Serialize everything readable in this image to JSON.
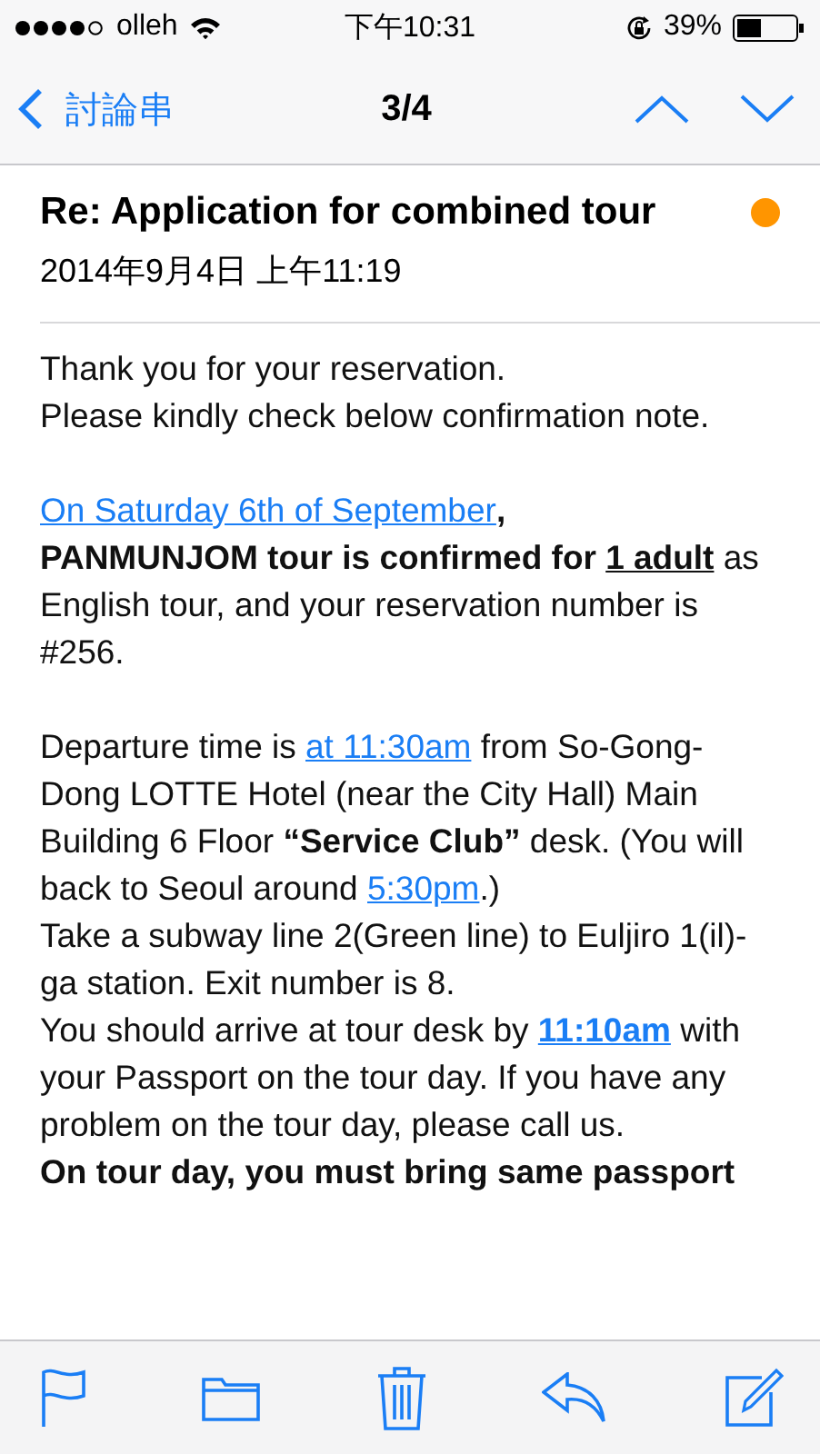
{
  "status_bar": {
    "carrier": "olleh",
    "time": "下午10:31",
    "battery": "39%"
  },
  "nav_bar": {
    "back": "討論串",
    "position": "3/4"
  },
  "message": {
    "subject": "Re: Application for combined tour",
    "unread": true,
    "date": "2014年9月4日 上午11:19",
    "blocks": [
      [
        {
          "segments": [
            {
              "kind": "text",
              "text": "Thank you for your reservation."
            }
          ]
        },
        {
          "segments": [
            {
              "kind": "text",
              "text": "Please kindly check below confirmation note."
            }
          ]
        }
      ],
      [
        {
          "segments": [
            {
              "kind": "link",
              "text": "On Saturday 6th of September"
            },
            {
              "kind": "bold",
              "text": ",\nPANMUNJOM tour is confirmed for "
            },
            {
              "kind": "bold_underline",
              "text": "1 adult"
            },
            {
              "kind": "text",
              "text": " as English tour, and your reservation number is #256."
            }
          ]
        }
      ],
      [
        {
          "segments": [
            {
              "kind": "text",
              "text": "Departure time is "
            },
            {
              "kind": "link",
              "text": "at 11:30am"
            },
            {
              "kind": "text",
              "text": " from So-Gong-Dong LOTTE Hotel (near the City Hall) Main Building 6 Floor "
            },
            {
              "kind": "bold",
              "text": "“Service Club”"
            },
            {
              "kind": "text",
              "text": " desk. (You will back to Seoul around "
            },
            {
              "kind": "link",
              "text": "5:30pm"
            },
            {
              "kind": "text",
              "text": ".)"
            }
          ]
        },
        {
          "segments": [
            {
              "kind": "text",
              "text": "Take a subway line 2(Green line) to Euljiro 1(il)-ga station. Exit number is 8."
            }
          ]
        },
        {
          "segments": [
            {
              "kind": "text",
              "text": "You should arrive at tour desk by "
            },
            {
              "kind": "bold_link",
              "text": "11:10am"
            },
            {
              "kind": "text",
              "text": " with your Passport on the tour day. If you have any problem on the tour day, please call us."
            }
          ]
        },
        {
          "segments": [
            {
              "kind": "bold",
              "text": "On tour day, you must bring same passport"
            }
          ]
        }
      ]
    ]
  }
}
